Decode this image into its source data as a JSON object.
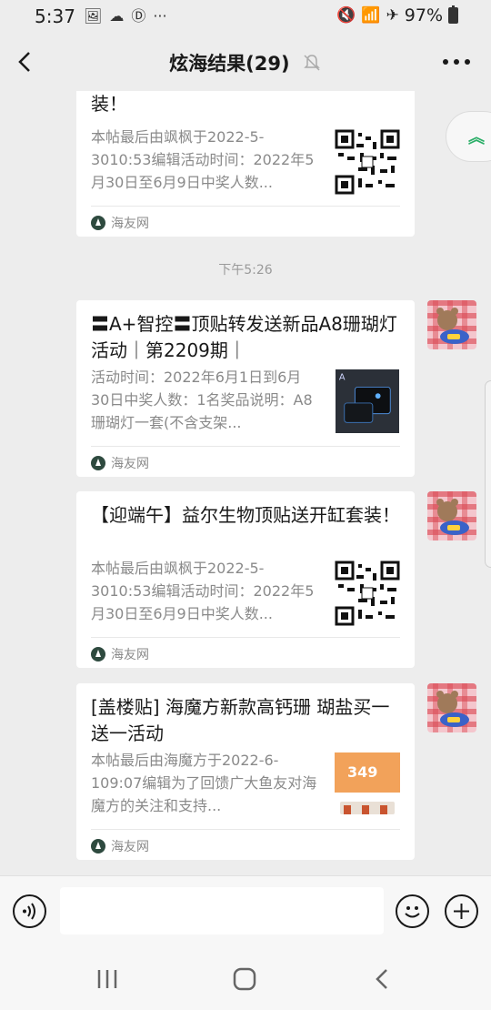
{
  "status": {
    "time": "5:37",
    "battery": "97%",
    "left_icons": [
      "image-icon",
      "cloud-icon",
      "app-icon",
      "more-dots-icon"
    ],
    "right_icons": [
      "mute-icon",
      "wifi-icon",
      "airplane-icon",
      "battery-icon"
    ]
  },
  "header": {
    "title": "炫海结果(29)",
    "icons": [
      "back-icon",
      "muted-bell-icon",
      "more-icon"
    ]
  },
  "messages": [
    {
      "title": "装！",
      "desc": "本帖最后由飒枫于2022-5-3010:53编辑活动时间：2022年5月30日至6月9日中奖人数...",
      "source": "海友网",
      "thumb": "qr-code"
    },
    {
      "title": "〓A+智控〓顶贴转发送新品A8珊瑚灯活动｜第2209期｜",
      "desc": "活动时间：2022年6月1日到6月30日中奖人数：1名奖品说明：A8珊瑚灯一套(不含支架...",
      "source": "海友网",
      "thumb": "product-image"
    },
    {
      "title": "【迎端午】益尔生物顶贴送开缸套装！",
      "desc": "本帖最后由飒枫于2022-5-3010:53编辑活动时间：2022年5月30日至6月9日中奖人数...",
      "source": "海友网",
      "thumb": "qr-code"
    },
    {
      "title": "[盖楼贴] 海魔方新款高钙珊 瑚盐买一送一活动",
      "desc": "本帖最后由海魔方于2022-6-109:07编辑为了回馈广大鱼友对海魔方的关注和支持...",
      "source": "海友网",
      "thumb": "promo-image",
      "thumb_text": "349"
    }
  ],
  "timestamp": "下午5:26",
  "colors": {
    "background": "#ededed",
    "card": "#ffffff",
    "muted_text": "#8a8a8a",
    "accent_green": "#2aae67"
  }
}
